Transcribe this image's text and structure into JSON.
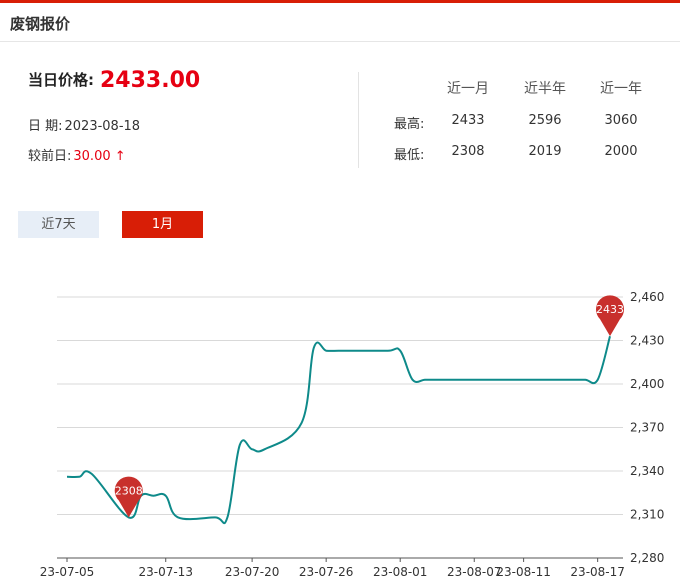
{
  "header": {
    "title": "废钢报价"
  },
  "today": {
    "label": "当日价格:",
    "price": "2433.00"
  },
  "date": {
    "label": "日  期:",
    "value": "2023-08-18"
  },
  "change": {
    "label": "较前日:",
    "value": "30.00",
    "arrow": "↑"
  },
  "stats": {
    "columns": [
      "近一月",
      "近半年",
      "近一年"
    ],
    "rows": [
      {
        "label": "最高:",
        "values": [
          "2433",
          "2596",
          "3060"
        ]
      },
      {
        "label": "最低:",
        "values": [
          "2308",
          "2019",
          "2000"
        ]
      }
    ]
  },
  "tabs": [
    {
      "label": "近7天",
      "active": false
    },
    {
      "label": "1月",
      "active": true
    }
  ],
  "colors": {
    "accent": "#d81e06",
    "line": "#0e8a8a",
    "up": "#e60012",
    "marker": "#c8302c"
  },
  "chart_data": {
    "type": "line",
    "title": "",
    "xlabel": "",
    "ylabel": "",
    "ylim": [
      2280,
      2460
    ],
    "yticks": [
      2280,
      2310,
      2340,
      2370,
      2400,
      2430,
      2460
    ],
    "ytick_labels": [
      "2,280",
      "2,310",
      "2,340",
      "2,370",
      "2,400",
      "2,430",
      "2,460"
    ],
    "xtick_labels": [
      "23-07-05",
      "23-07-13",
      "23-07-20",
      "23-07-26",
      "23-08-01",
      "23-08-07",
      "23-08-11",
      "23-08-17"
    ],
    "grid": true,
    "y_axis_position": "right",
    "series": [
      {
        "x": [
          "23-07-05",
          "23-07-06",
          "23-07-07",
          "23-07-10",
          "23-07-11",
          "23-07-12",
          "23-07-13",
          "23-07-14",
          "23-07-17",
          "23-07-18",
          "23-07-19",
          "23-07-20",
          "23-07-21",
          "23-07-24",
          "23-07-25",
          "23-07-26",
          "23-07-27",
          "23-07-28",
          "23-07-31",
          "23-08-01",
          "23-08-02",
          "23-08-03",
          "23-08-04",
          "23-08-07",
          "23-08-08",
          "23-08-09",
          "23-08-10",
          "23-08-11",
          "23-08-14",
          "23-08-15",
          "23-08-16",
          "23-08-17",
          "23-08-18"
        ],
        "values": [
          2336,
          2336,
          2338,
          2308,
          2323,
          2323,
          2323,
          2308,
          2308,
          2308,
          2358,
          2355,
          2355,
          2373,
          2425,
          2423,
          2423,
          2423,
          2423,
          2423,
          2403,
          2403,
          2403,
          2403,
          2403,
          2403,
          2403,
          2403,
          2403,
          2403,
          2403,
          2403,
          2433
        ]
      }
    ],
    "markers": [
      {
        "x": "23-07-10",
        "value": 2308,
        "label": "2308"
      },
      {
        "x": "23-08-18",
        "value": 2433,
        "label": "2433"
      }
    ]
  }
}
